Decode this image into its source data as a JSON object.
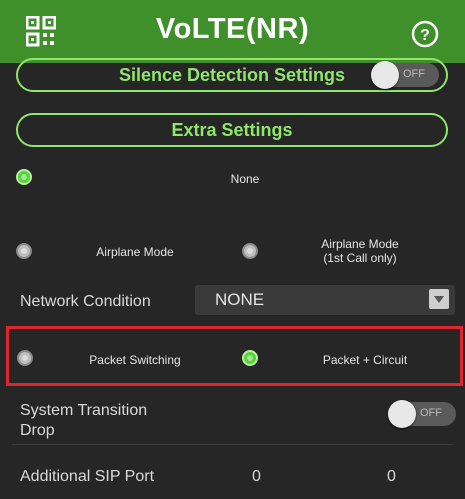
{
  "header": {
    "title": "VoLTE(NR)",
    "icons": [
      "qr-code-icon",
      "help-icon"
    ],
    "color": "#3f8f2b"
  },
  "silence_detection": {
    "label": "Silence Detection Settings",
    "toggle_text": "OFF",
    "enabled": false
  },
  "extra_settings": {
    "label": "Extra Settings"
  },
  "mode_options": {
    "none_label": "None",
    "airplane_label": "Airplane Mode",
    "airplane_first_call_line1": "Airplane Mode",
    "airplane_first_call_line2": "(1st Call only)",
    "selected": "None"
  },
  "network_condition": {
    "label": "Network Condition",
    "value": "NONE"
  },
  "switching": {
    "packet_label": "Packet Switching",
    "packet_circuit_label": "Packet + Circuit",
    "selected": "Packet + Circuit"
  },
  "system_transition_drop": {
    "label_line1": "System Transition",
    "label_line2": "Drop",
    "toggle_text": "OFF",
    "enabled": false
  },
  "additional_sip_port": {
    "label": "Additional SIP Port",
    "value1": "0",
    "value2": "0"
  },
  "colors": {
    "accent": "#8ee66b",
    "highlight": "#e0262d",
    "background": "#262626"
  }
}
